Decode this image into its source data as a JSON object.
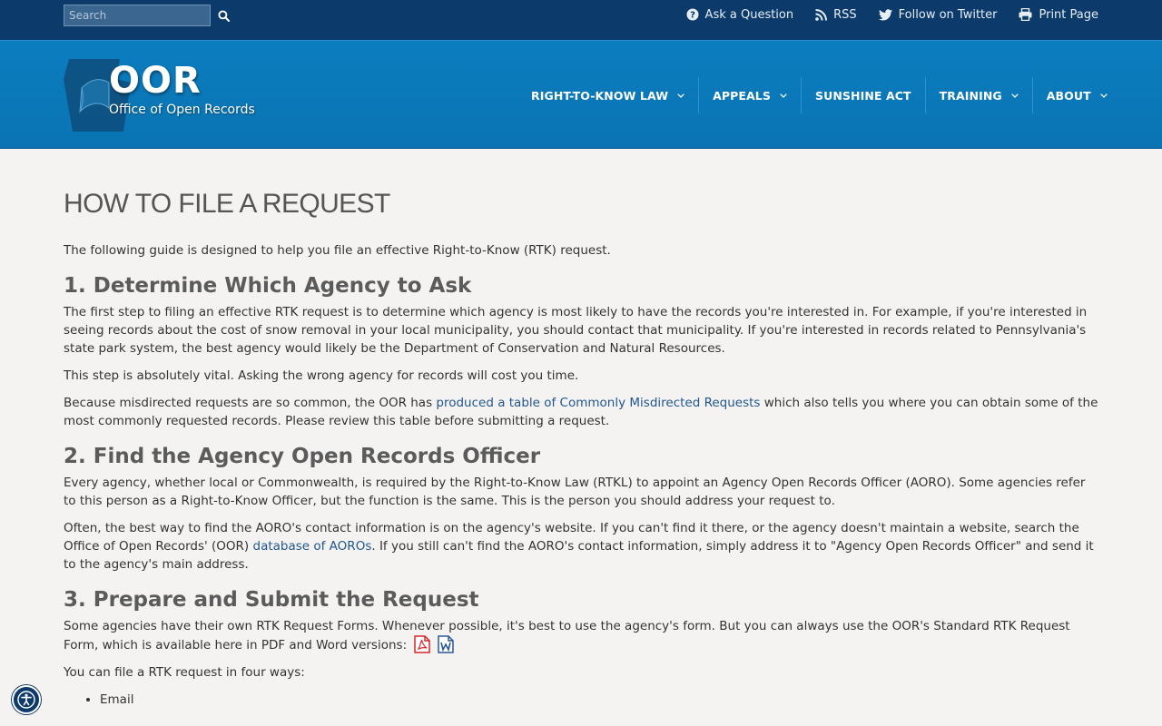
{
  "topbar": {
    "search": {
      "placeholder": "Search",
      "value": ""
    },
    "links": [
      {
        "label": "Ask a Question",
        "icon": "question-circle-icon"
      },
      {
        "label": "RSS",
        "icon": "rss-icon"
      },
      {
        "label": "Follow on Twitter",
        "icon": "twitter-icon"
      },
      {
        "label": "Print Page",
        "icon": "print-icon"
      }
    ]
  },
  "header": {
    "logo_title": "OOR",
    "logo_subtitle": "Office of Open Records",
    "nav": [
      {
        "label": "RIGHT-TO-KNOW LAW",
        "dropdown": true
      },
      {
        "label": "APPEALS",
        "dropdown": true
      },
      {
        "label": "SUNSHINE ACT",
        "dropdown": false
      },
      {
        "label": "TRAINING",
        "dropdown": true
      },
      {
        "label": "ABOUT",
        "dropdown": true
      }
    ]
  },
  "main": {
    "title": "HOW TO FILE A REQUEST",
    "intro": "The following guide is designed to help you file an effective Right-to-Know (RTK) request.",
    "s1": {
      "heading": "1. Determine Which Agency to Ask",
      "p1": "The first step to filing an effective RTK request is to determine which agency is most likely to have the records you're interested in. For example, if you're interested in seeing records about the cost of snow removal in your local municipality, you should contact that municipality. If you're interested in records related to Pennsylvania's state park system, the best agency would likely be the Department of Conservation and Natural Resources.",
      "p2": "This step is absolutely vital. Asking the wrong agency for records will cost you time.",
      "p3_before": "Because misdirected requests are so common, the OOR has ",
      "p3_link": "produced a table of Commonly Misdirected Requests",
      "p3_after": " which also tells you where you can obtain some of the most commonly requested records. Please review this table before submitting a request."
    },
    "s2": {
      "heading": "2. Find the Agency Open Records Officer",
      "p1": "Every agency, whether local or Commonwealth, is required by the Right-to-Know Law (RTKL) to appoint an Agency Open Records Officer (AORO). Some agencies refer to this person as a Right-to-Know Officer, but the function is the same. This is the person you should address your request to.",
      "p2_before": "Often, the best way to find the AORO's contact information is on the agency's website. If you can't find it there, or the agency doesn't maintain a website, search the Office of Open Records' (OOR) ",
      "p2_link": "database of AOROs",
      "p2_after": ". If you still can't find the AORO's contact information, simply address it to \"Agency Open Records Officer\" and send it to the agency's main address."
    },
    "s3": {
      "heading": "3. Prepare and Submit the Request",
      "p1": "Some agencies have their own RTK Request Forms. Whenever possible, it's best to use the agency's form. But you can always use the OOR's Standard RTK Request Form, which is available here in PDF and Word versions:",
      "p2": "You can file a RTK request in four ways:",
      "ways": [
        "Email"
      ]
    }
  },
  "colors": {
    "topbar_bg": "#0b3a6b",
    "header_bg": "#0a76b6",
    "link": "#21578f",
    "heading": "#5b5b5b",
    "page_bg": "#f4f3f1",
    "pdf_red": "#d7262b",
    "word_blue": "#2b5797"
  }
}
